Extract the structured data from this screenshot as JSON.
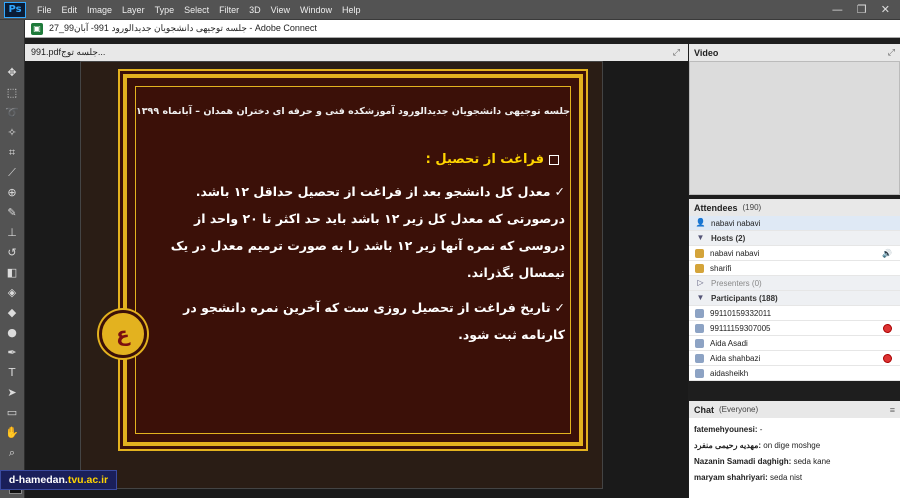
{
  "menubar": {
    "logo": "Ps",
    "items": [
      "File",
      "Edit",
      "Image",
      "Layer",
      "Type",
      "Select",
      "Filter",
      "3D",
      "View",
      "Window",
      "Help"
    ],
    "controls": [
      "—",
      "❐",
      "✕"
    ]
  },
  "window": {
    "title": "جلسه توجیهی دانشجویان جدیدالورود 991- آبان99_27 - Adobe Connect"
  },
  "share": {
    "filename": "991.pdfجلسه توج...",
    "slide": {
      "title": "جلسه توجیهی دانشجویان جدیدالورود آموزشکده فنی و حرفه ای دختران همدان – آبانماه ۱۳۹۹",
      "heading": "فراغت از تحصیل :",
      "para1": "معدل کل دانشجو بعد از فراغت از تحصیل حداقل ۱۲ باشد. درصورتی که معدل کل زیر ۱۲ باشد باید حد اکثر تا ۲۰ واحد از دروسی که نمره آنها زیر ۱۲ باشد را به صورت ترمیم معدل در یک نیمسال بگذراند.",
      "para2": "تاریخ فراغت از تحصیل روزی ست که آخرین نمره دانشجو در کارنامه ثبت شود."
    }
  },
  "video": {
    "title": "Video"
  },
  "attendees": {
    "title": "Attendees",
    "count": "(190)",
    "me": "nabavi nabavi",
    "hosts_label": "Hosts (2)",
    "hosts": [
      "nabavi nabavi",
      "sharifi"
    ],
    "presenters_label": "Presenters (0)",
    "participants_label": "Participants (188)",
    "participants": [
      "99110159332011",
      "99111159307005",
      "Aida Asadi",
      "Aida shahbazi",
      "aidasheikh"
    ]
  },
  "chat": {
    "title": "Chat",
    "scope": "(Everyone)",
    "messages": [
      {
        "name": "fatemehyounesi:",
        "text": " -"
      },
      {
        "name": "مهدیه رحیمی منفرد:",
        "text": " on dige moshge"
      },
      {
        "name": "Nazanin Samadi daghigh:",
        "text": " seda kane"
      },
      {
        "name": "maryam shahriyari:",
        "text": " seda nist"
      }
    ]
  },
  "watermark": {
    "prefix": "d-hamedan.",
    "accent": "tvu.ac.ir"
  }
}
